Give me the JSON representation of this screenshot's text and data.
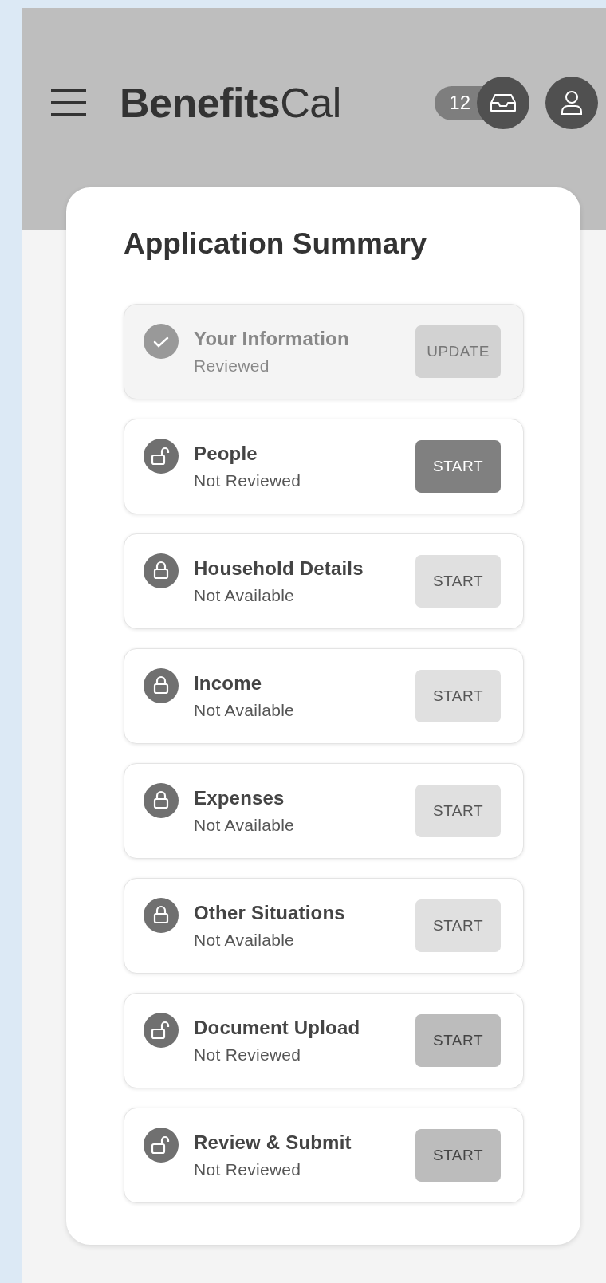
{
  "header": {
    "logo": {
      "bold": "Benefits",
      "regular": "Cal"
    },
    "inbox_count": "12"
  },
  "summary": {
    "title": "Application Summary",
    "items": [
      {
        "title": "Your Information",
        "status_text": "Reviewed",
        "kind": "reviewed",
        "button": {
          "label": "UPDATE",
          "emphasized": false
        }
      },
      {
        "title": "People",
        "status_text": "Not Reviewed",
        "kind": "open",
        "button": {
          "label": "START",
          "emphasized": true
        }
      },
      {
        "title": "Household Details",
        "status_text": "Not Available",
        "kind": "locked",
        "button": {
          "label": "START",
          "emphasized": false
        }
      },
      {
        "title": "Income",
        "status_text": "Not Available",
        "kind": "locked",
        "button": {
          "label": "START",
          "emphasized": false
        }
      },
      {
        "title": "Expenses",
        "status_text": "Not Available",
        "kind": "locked",
        "button": {
          "label": "START",
          "emphasized": false
        }
      },
      {
        "title": "Other Situations",
        "status_text": "Not Available",
        "kind": "locked",
        "button": {
          "label": "START",
          "emphasized": false
        }
      },
      {
        "title": "Document Upload",
        "status_text": "Not Reviewed",
        "kind": "open",
        "button": {
          "label": "START",
          "emphasized": false
        }
      },
      {
        "title": "Review & Submit",
        "status_text": "Not Reviewed",
        "kind": "open",
        "button": {
          "label": "START",
          "emphasized": false
        }
      }
    ]
  }
}
